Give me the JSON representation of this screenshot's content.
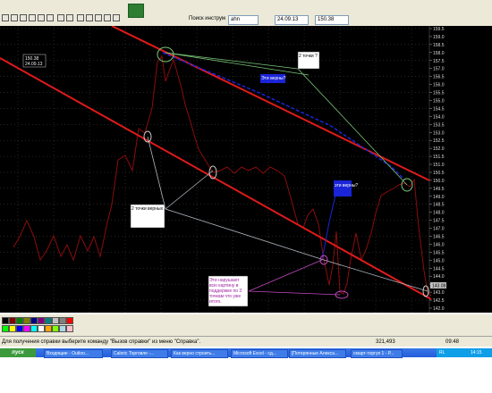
{
  "toolbar": {
    "search_label": "Поиск инструм",
    "search_value": "ahn",
    "date_value": "24.09.13",
    "price_value": "150.38"
  },
  "chart": {
    "cursor_price": "150.38",
    "cursor_date": "24.09.13",
    "current_price": "143.08",
    "price_ticks": [
      "159.5",
      "159.0",
      "158.5",
      "158.0",
      "157.5",
      "157.0",
      "156.5",
      "156.0",
      "155.5",
      "155.0",
      "154.5",
      "154.0",
      "153.5",
      "153.0",
      "152.5",
      "152.0",
      "151.5",
      "151.0",
      "150.5",
      "150.0",
      "149.5",
      "149.0",
      "148.5",
      "148.0",
      "147.5",
      "147.0",
      "146.5",
      "146.0",
      "145.5",
      "145.0",
      "144.5",
      "144.0",
      "143.5",
      "143.0",
      "142.5",
      "142.0"
    ],
    "notes": {
      "n1": "2 точки ?",
      "n2": "Эти верны?",
      "n3": "эти верны?",
      "n4": "2 точки верных",
      "n5_lines": [
        "Эти нарушают",
        "всю картину в",
        "поддержке по 3",
        "точкам что уже",
        "итого."
      ]
    },
    "colors": {
      "background": "#000000",
      "trend": "#e01a1a",
      "price": "#8a0d0d",
      "grid": "#555555"
    }
  },
  "statusbar": {
    "help": "Для получения справки выберите команду \"Вызов справки\" из меню \"Справка\".",
    "coords": "321,493",
    "time": "09:48"
  },
  "taskbar": {
    "start": "пуск",
    "tasks": [
      "Входящие - Outloo...",
      "Caloric Торговле -...",
      "Как верно строить...",
      "Microsoft Excel - сд...",
      "[Потерянные Алекса...",
      "смарт-торгуя 1 - Р..."
    ],
    "tray_lang": "RL",
    "tray_time": "14:15"
  }
}
